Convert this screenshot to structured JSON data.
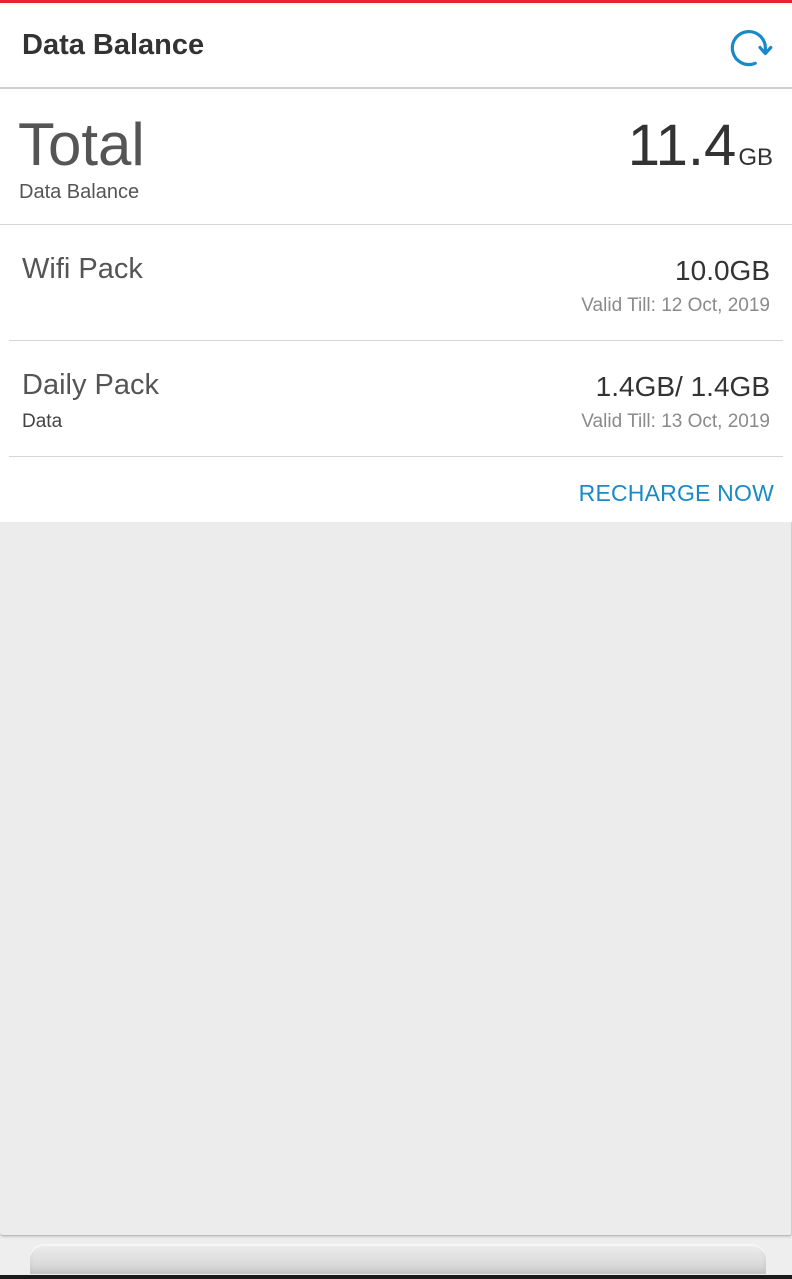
{
  "colors": {
    "accent_top": "#e8222e",
    "refresh_icon": "#1a8ac6",
    "link": "#1a8ac6"
  },
  "header": {
    "title": "Data Balance",
    "refresh_icon": "refresh-icon"
  },
  "total": {
    "label": "Total",
    "sublabel": "Data Balance",
    "value": "11.4",
    "unit": "GB"
  },
  "packs": [
    {
      "name": "Wifi Pack",
      "sub": "",
      "amount": "10.0GB",
      "valid": "Valid Till: 12 Oct, 2019"
    },
    {
      "name": "Daily Pack",
      "sub": "Data",
      "amount": "1.4GB/ 1.4GB",
      "valid": "Valid Till: 13 Oct, 2019"
    }
  ],
  "actions": {
    "recharge_label": "RECHARGE NOW"
  }
}
